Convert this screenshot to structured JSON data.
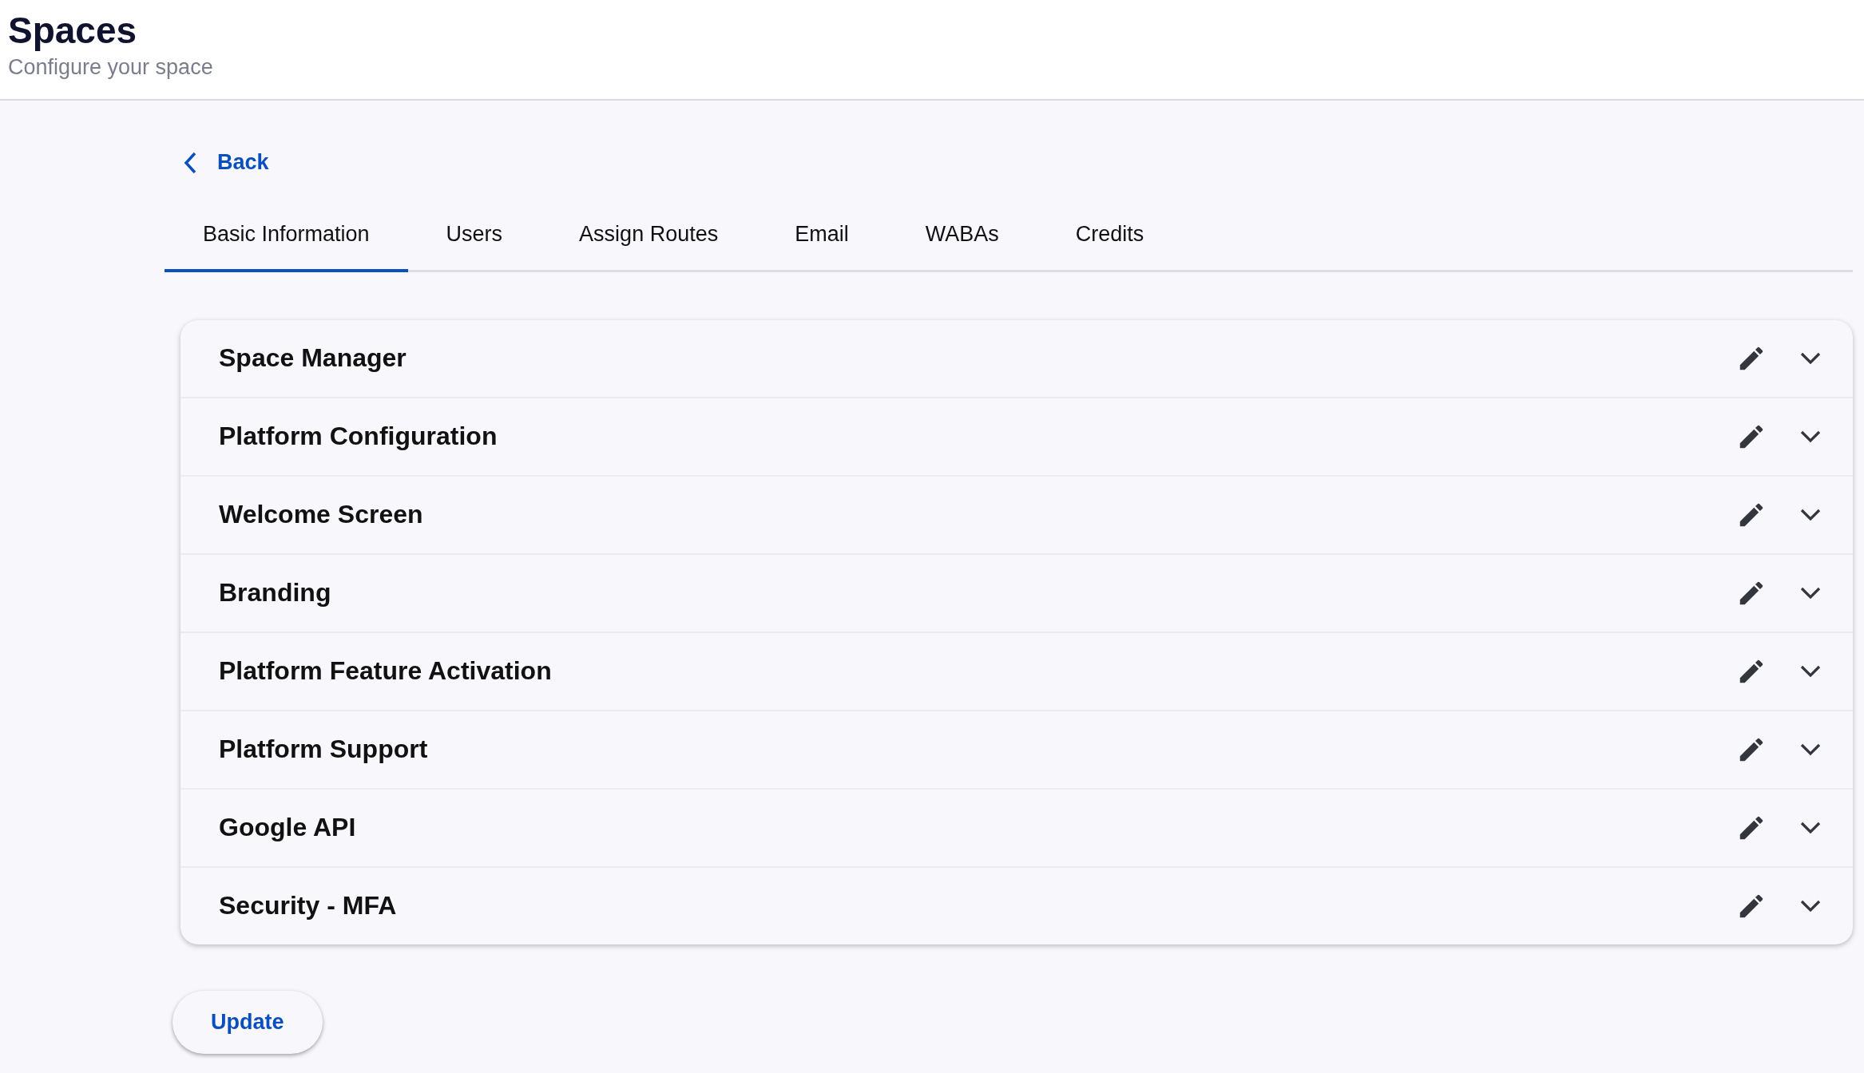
{
  "header": {
    "title": "Spaces",
    "subtitle": "Configure your space"
  },
  "back": {
    "label": "Back"
  },
  "tabs": [
    {
      "label": "Basic Information",
      "selected": true
    },
    {
      "label": "Users",
      "selected": false
    },
    {
      "label": "Assign Routes",
      "selected": false
    },
    {
      "label": "Email",
      "selected": false
    },
    {
      "label": "WABAs",
      "selected": false
    },
    {
      "label": "Credits",
      "selected": false
    }
  ],
  "sections": [
    {
      "title": "Space Manager",
      "expanded": false
    },
    {
      "title": "Platform Configuration",
      "expanded": false
    },
    {
      "title": "Welcome Screen",
      "expanded": false
    },
    {
      "title": "Branding",
      "expanded": false
    },
    {
      "title": "Platform Feature Activation",
      "expanded": false
    },
    {
      "title": "Platform Support",
      "expanded": false
    },
    {
      "title": "Google API",
      "expanded": false
    },
    {
      "title": "Security - MFA",
      "expanded": false
    }
  ],
  "update_button": "Update"
}
